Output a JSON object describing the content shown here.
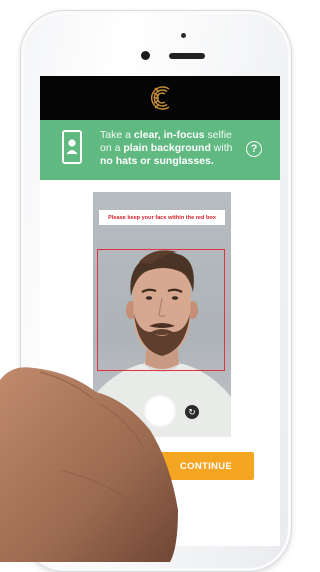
{
  "banner": {
    "line1_pre": "Take a ",
    "line1_bold": "clear, in-focus",
    "line1_post": " selfie",
    "line2_pre": "on a ",
    "line2_bold": "plain background",
    "line2_post": " with",
    "line3_bold": "no hats or sunglasses.",
    "help_label": "?"
  },
  "camera": {
    "hint": "Please keep your face within the red box"
  },
  "actions": {
    "continue_label": "CONTINUE"
  },
  "icons": {
    "logo": "c-logo-icon",
    "selfie": "selfie-person-icon",
    "help": "help-icon",
    "shutter": "shutter-button",
    "switch": "switch-camera-icon"
  },
  "colors": {
    "header": "#050505",
    "banner": "#5fb981",
    "accent": "#f4a623",
    "logo": "#c8903c",
    "box": "#e0313c"
  }
}
